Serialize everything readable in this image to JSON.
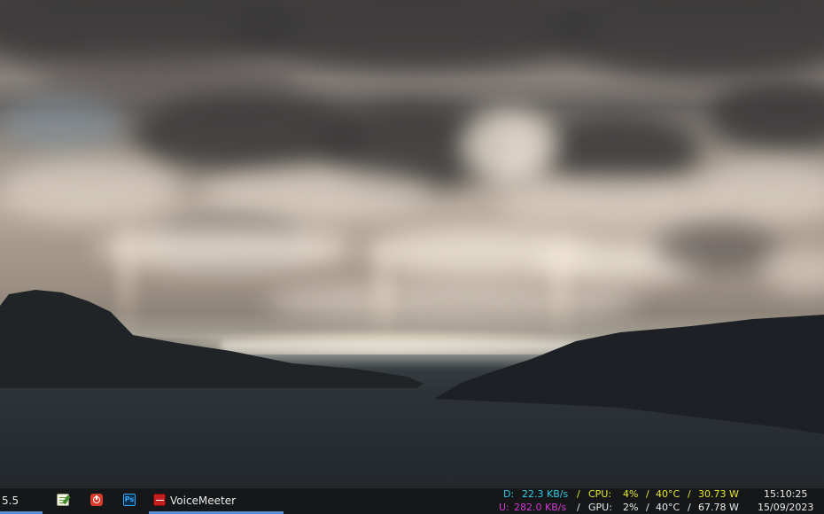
{
  "taskbar": {
    "partial_label": "5.5",
    "apps": [
      {
        "name": "notepad",
        "icon": "notepad-icon"
      },
      {
        "name": "power-app",
        "icon": "power-icon"
      },
      {
        "name": "photoshop",
        "icon": "photoshop-icon",
        "glyph": "Ps"
      },
      {
        "name": "voicemeeter",
        "icon": "voicemeeter-icon",
        "label": "VoiceMeeter"
      }
    ],
    "network": {
      "down_label": "D:",
      "down_value": "22.3 KB/s",
      "up_label": "U:",
      "up_value": "282.0 KB/s"
    },
    "cpu": {
      "label": "CPU:",
      "usage": "4%",
      "temp": "40°C",
      "power": "30.73 W"
    },
    "gpu": {
      "label": "GPU:",
      "usage": "2%",
      "temp": "40°C",
      "power": "67.78 W"
    },
    "separator": "/",
    "clock": {
      "time": "15:10:25",
      "date": "15/09/2023"
    }
  },
  "colors": {
    "network_down": "#2ec9e6",
    "network_up": "#d23ad2",
    "cpu": "#e6e628",
    "gpu": "#e9e9e9",
    "accent_underline": "#5a8fd6"
  }
}
